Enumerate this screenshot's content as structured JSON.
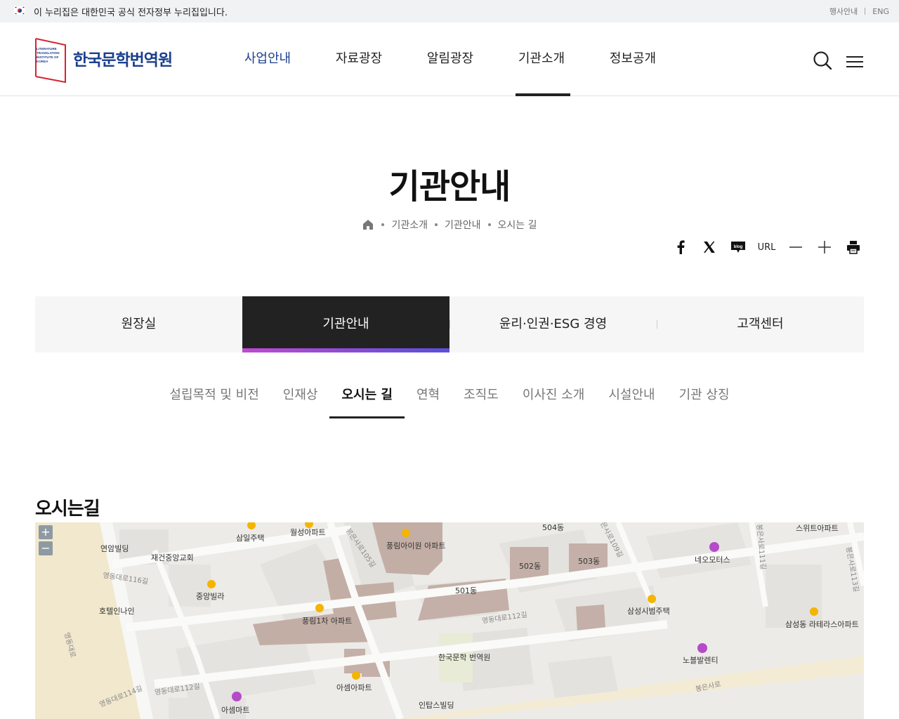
{
  "gov_banner": {
    "text": "이 누리집은 대한민국 공식 전자정부 누리집입니다.",
    "links": [
      "행사안내",
      "ENG"
    ]
  },
  "header": {
    "logo_small": [
      "LITERATURE",
      "TRANSLATION",
      "INSTITUTE OF",
      "KOREA"
    ],
    "logo_name": "한국문학번역원",
    "nav": [
      "사업안내",
      "자료광장",
      "알림광장",
      "기관소개",
      "정보공개"
    ],
    "search_icon": "search-icon",
    "menu_icon": "hamburger-icon"
  },
  "page": {
    "title": "기관안내",
    "breadcrumb": [
      "기관소개",
      "기관안내",
      "오시는 길"
    ]
  },
  "tools": {
    "items": [
      "facebook-icon",
      "x-icon",
      "blog-icon",
      "url",
      "zoom-out-icon",
      "zoom-in-icon",
      "print-icon"
    ],
    "blog_label": "blog",
    "url_label": "URL"
  },
  "tabs": [
    "원장실",
    "기관안내",
    "윤리·인권·ESG 경영",
    "고객센터"
  ],
  "subtabs": [
    "설립목적 및 비전",
    "인재상",
    "오시는 길",
    "연혁",
    "조직도",
    "이사진 소개",
    "시설안내",
    "기관 상징"
  ],
  "section": {
    "title": "오시는길"
  },
  "map": {
    "zoom_in": "+",
    "zoom_out": "−",
    "labels": [
      "연암빌딩",
      "재건중앙교회",
      "삼일주택",
      "월성아파트",
      "풍림아이원 아파트",
      "504동",
      "502동",
      "503동",
      "501동",
      "스위트아파트",
      "네오모터스",
      "중앙빌라",
      "호텔인나인",
      "풍림1차 아파트",
      "삼성시범주택",
      "삼성동 라테라스아파트",
      "한국문학 번역원",
      "노블발렌티",
      "아셈아파트",
      "아셈마트",
      "인탑스빌딩",
      "영동대로",
      "봉은사로"
    ],
    "roads": [
      "영동대로116길",
      "영동대로114길",
      "영동대로112길",
      "봉은사로105길",
      "봉은사로109길",
      "봉은사로111길",
      "봉은사로113길",
      "영동대로112길"
    ]
  },
  "colors": {
    "brand_blue": "#1b3f8e",
    "brand_red": "#d7242f",
    "active_tab": "#222222"
  }
}
